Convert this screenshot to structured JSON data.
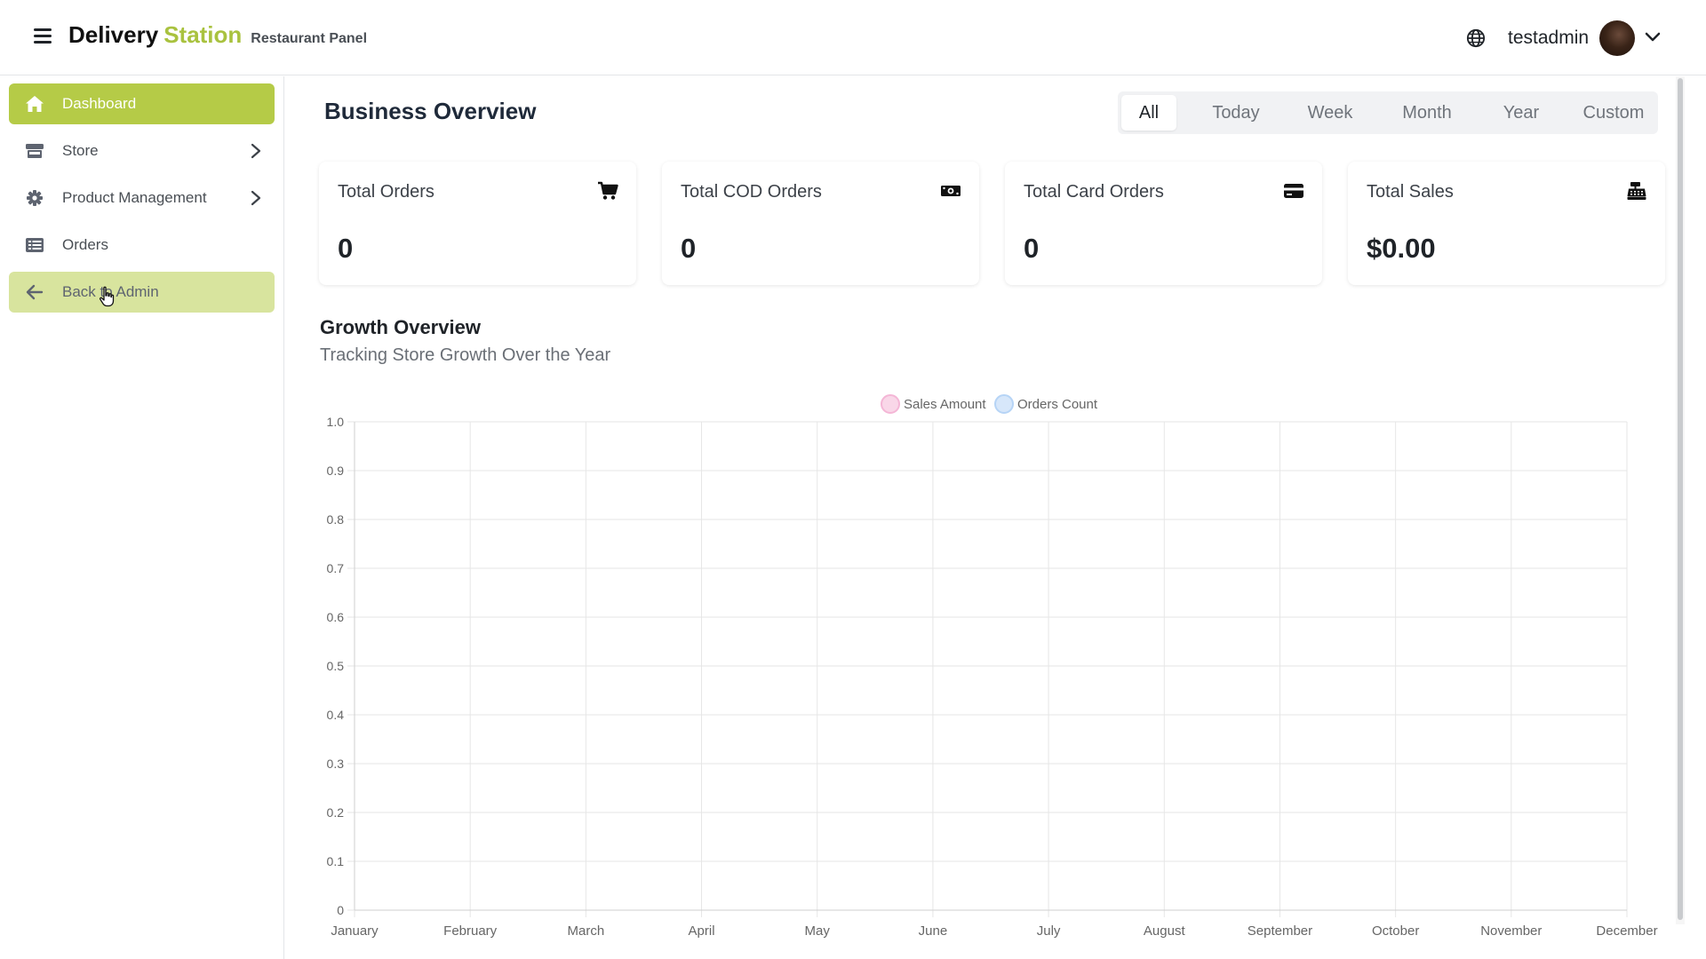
{
  "header": {
    "brand_main": "Delivery",
    "brand_accent": "Station",
    "brand_sub": "Restaurant Panel",
    "username": "testadmin"
  },
  "sidebar": {
    "items": [
      {
        "label": "Dashboard",
        "icon": "home-icon",
        "state": "active",
        "has_chevron": false
      },
      {
        "label": "Store",
        "icon": "store-icon",
        "state": "default",
        "has_chevron": true
      },
      {
        "label": "Product Management",
        "icon": "gear-icon",
        "state": "default",
        "has_chevron": true
      },
      {
        "label": "Orders",
        "icon": "list-icon",
        "state": "default",
        "has_chevron": false
      },
      {
        "label": "Back to Admin",
        "icon": "arrow-left-icon",
        "state": "hover",
        "has_chevron": false
      }
    ]
  },
  "main": {
    "title": "Business Overview",
    "filters": {
      "tabs": [
        "All",
        "Today",
        "Week",
        "Month",
        "Year",
        "Custom"
      ],
      "active": "All"
    },
    "stats": [
      {
        "label": "Total Orders",
        "value": "0",
        "icon": "cart-icon"
      },
      {
        "label": "Total COD Orders",
        "value": "0",
        "icon": "cash-icon"
      },
      {
        "label": "Total Card Orders",
        "value": "0",
        "icon": "card-icon"
      },
      {
        "label": "Total Sales",
        "value": "$0.00",
        "icon": "cash-register-icon"
      }
    ],
    "growth": {
      "title": "Growth Overview",
      "subtitle": "Tracking Store Growth Over the Year"
    }
  },
  "colors": {
    "accent": "#b5cb47",
    "accent_soft": "#d8e49e",
    "brand_accent": "#a9c23f",
    "sales_series": "#f4b6d6",
    "orders_series": "#b6d4f6"
  },
  "chart_data": {
    "type": "line",
    "categories": [
      "January",
      "February",
      "March",
      "April",
      "May",
      "June",
      "July",
      "August",
      "September",
      "October",
      "November",
      "December"
    ],
    "series": [
      {
        "name": "Sales Amount",
        "values": [],
        "color": "#f4b6d6"
      },
      {
        "name": "Orders Count",
        "values": [],
        "color": "#b6d4f6"
      }
    ],
    "y_ticks": [
      "0",
      "0.1",
      "0.2",
      "0.3",
      "0.4",
      "0.5",
      "0.6",
      "0.7",
      "0.8",
      "0.9",
      "1.0"
    ],
    "ylim": [
      0,
      1
    ],
    "grid": true,
    "legend_position": "top-center"
  }
}
